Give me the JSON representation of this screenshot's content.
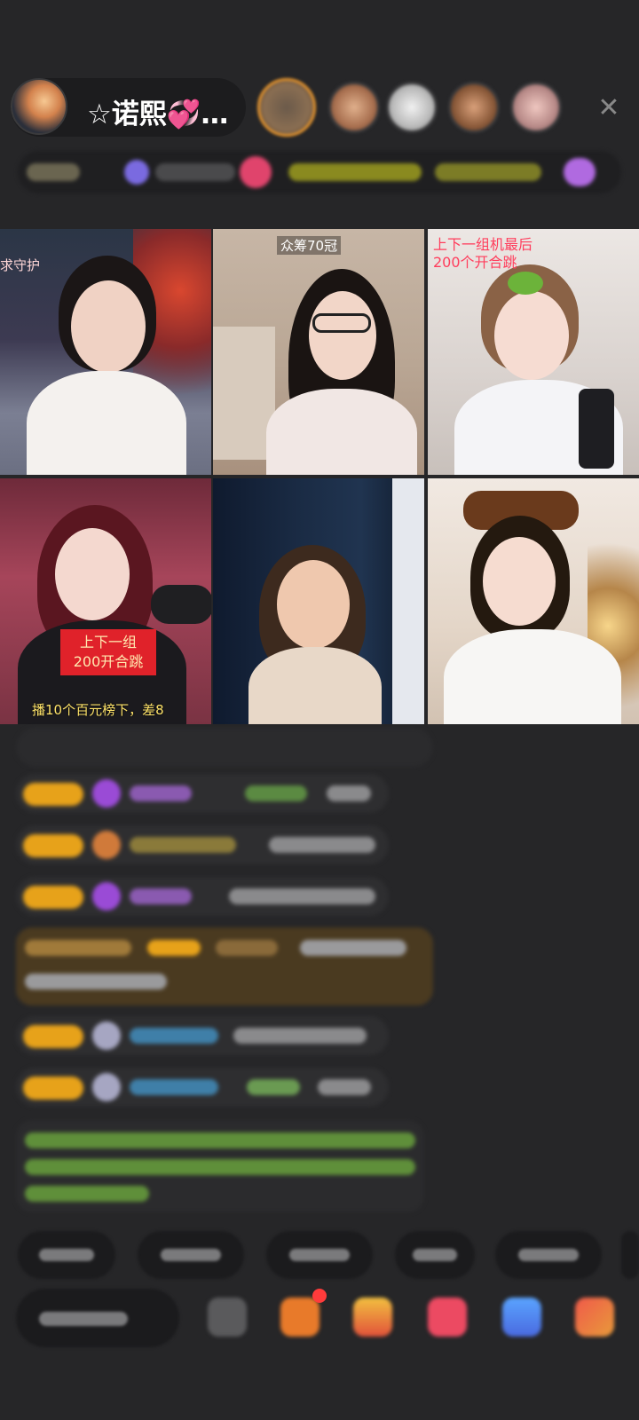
{
  "header": {
    "host_name": "☆诺熙💞…",
    "close_glyph": "✕"
  },
  "grid": {
    "tiles": [
      {
        "caption": "求守护"
      },
      {
        "caption": "众筹70冠"
      },
      {
        "caption": "上下一组机最后\n200个开合跳"
      },
      {
        "caption": ""
      },
      {
        "caption": ""
      },
      {
        "caption": ""
      }
    ],
    "tile4_box": "上下一组\n200开合跳",
    "tile4_bottom": "播10个百元榜下，差8"
  },
  "colors": {
    "accent_orange": "#e5942d",
    "level_badge": "#e7a21a",
    "purple_gem": "#9a4bd6",
    "chat_green": "#7fbf4a",
    "chat_blue": "#4aa3d6"
  }
}
